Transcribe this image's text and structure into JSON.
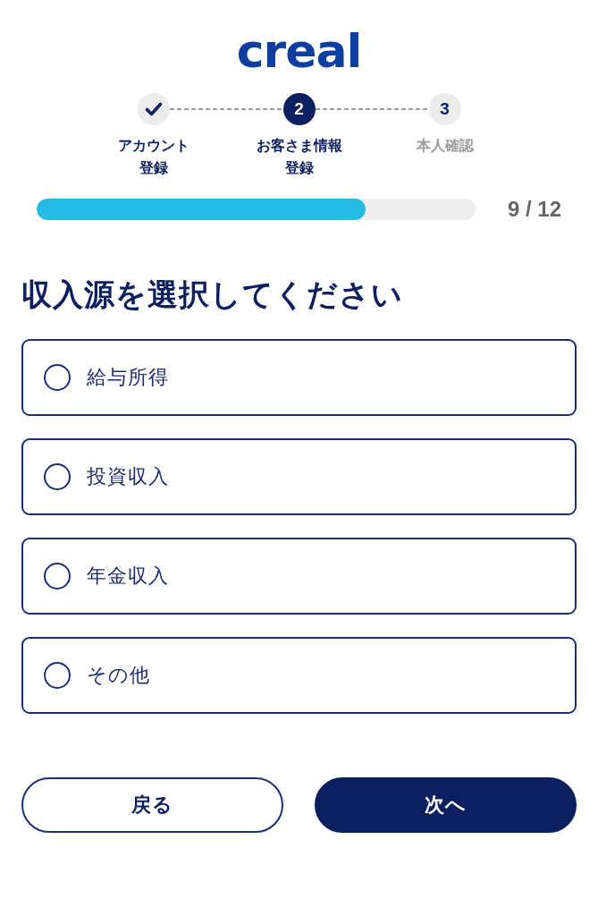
{
  "logo": {
    "text": "creal"
  },
  "steps": [
    {
      "kind": "done",
      "label_lines": [
        "アカウント",
        "登録"
      ]
    },
    {
      "kind": "current",
      "number": "2",
      "label_lines": [
        "お客さま情報",
        "登録"
      ]
    },
    {
      "kind": "upcoming",
      "number": "3",
      "label_lines": [
        "本人確認"
      ]
    }
  ],
  "progress": {
    "level": 0.75,
    "reading": "9 / 12"
  },
  "question": "収入源を選択してください",
  "options": [
    {
      "label": "給与所得",
      "selected": false
    },
    {
      "label": "投資収入",
      "selected": false
    },
    {
      "label": "年金収入",
      "selected": false
    },
    {
      "label": "その他",
      "selected": false
    }
  ],
  "buttons": [
    {
      "kind": "secondary",
      "label": "戻る"
    },
    {
      "kind": "primary",
      "label": "次へ"
    }
  ]
}
